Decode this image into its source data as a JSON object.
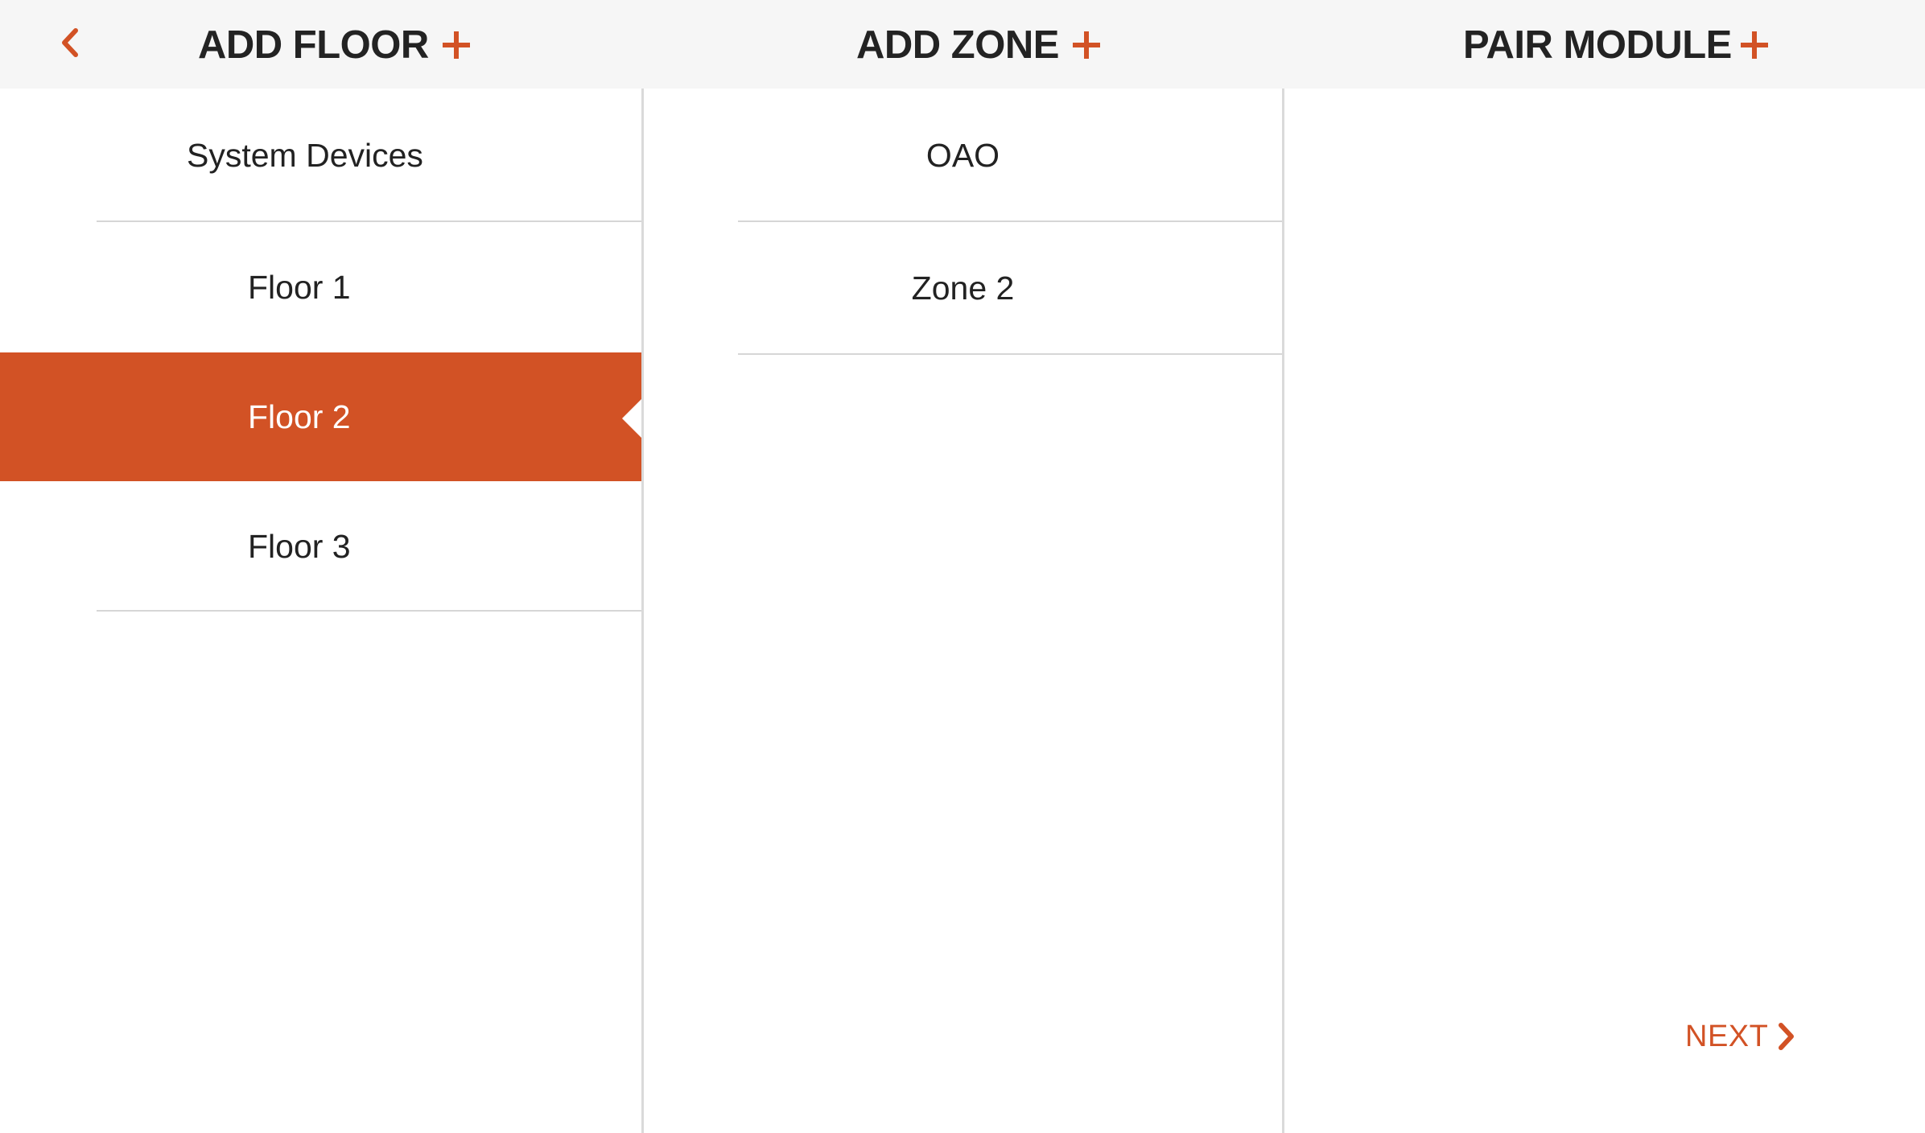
{
  "header": {
    "add_floor_label": "ADD FLOOR",
    "add_zone_label": "ADD ZONE",
    "pair_module_label": "PAIR MODULE"
  },
  "floors": {
    "items": [
      {
        "label": "System Devices",
        "selected": false
      },
      {
        "label": "Floor 1",
        "selected": false
      },
      {
        "label": "Floor 2",
        "selected": true
      },
      {
        "label": "Floor 3",
        "selected": false
      }
    ]
  },
  "zones": {
    "items": [
      {
        "label": "OAO"
      },
      {
        "label": "Zone 2"
      }
    ]
  },
  "footer": {
    "next_label": "NEXT"
  },
  "colors": {
    "accent": "#d25225",
    "header_bg": "#f6f6f6",
    "divider": "#d6d6d6",
    "column_border": "#dadada"
  },
  "icons": {
    "back": "chevron-left-icon",
    "add": "plus-icon",
    "next": "chevron-right-icon"
  }
}
